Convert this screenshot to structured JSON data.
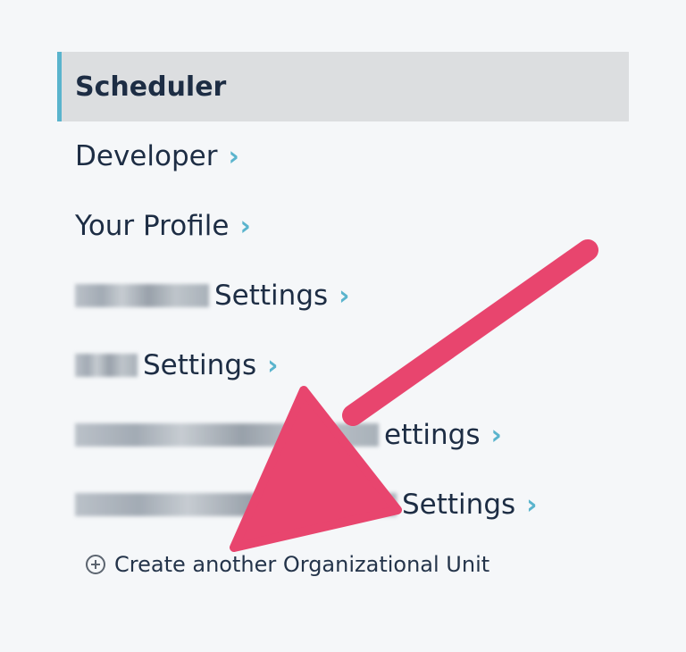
{
  "nav": {
    "items": [
      {
        "label": "Scheduler",
        "active": true
      },
      {
        "label": "Developer"
      },
      {
        "label": "Your Profile"
      },
      {
        "label": "Settings",
        "redacted": true
      },
      {
        "label": "Settings",
        "redacted": true
      },
      {
        "label": "ettings",
        "redacted": true
      },
      {
        "label": "Settings",
        "redacted": true
      }
    ],
    "chevron": "›"
  },
  "create_link": {
    "label": "Create another Organizational Unit",
    "icon": "plus-circle-icon"
  },
  "annotation": {
    "color": "#e8456e",
    "icon": "pink-arrow-annotation"
  }
}
